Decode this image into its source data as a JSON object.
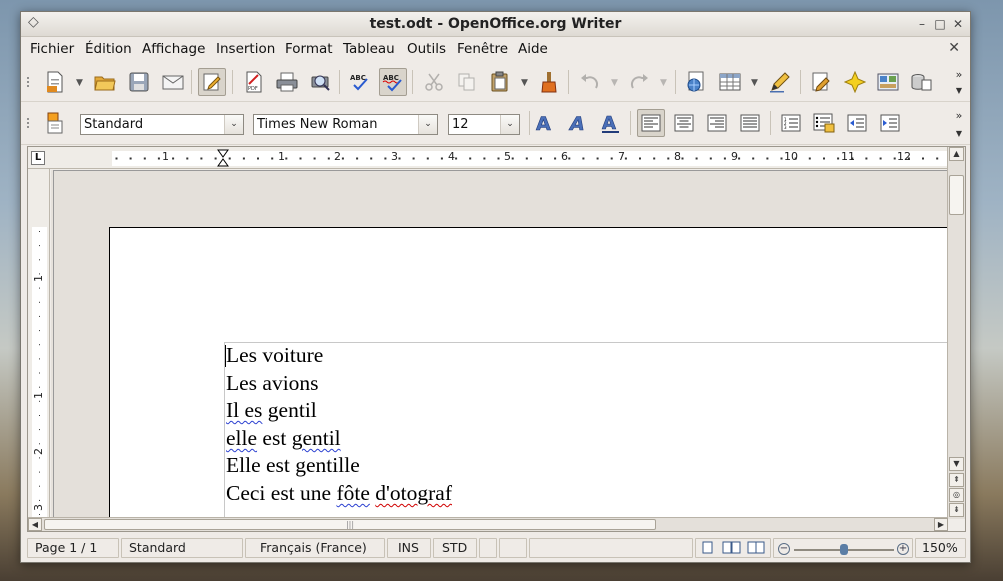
{
  "window": {
    "title": "test.odt - OpenOffice.org Writer",
    "menu_glyph": "◇",
    "minimize_glyph": "–",
    "maximize_glyph": "□",
    "close_glyph": "✕"
  },
  "menu": {
    "items": [
      "Fichier",
      "Édition",
      "Affichage",
      "Insertion",
      "Format",
      "Tableau",
      "Outils",
      "Fenêtre",
      "Aide"
    ],
    "close_doc_glyph": "✕"
  },
  "toolbar_standard": {
    "buttons": [
      {
        "icon": "new-document-icon"
      },
      {
        "icon": "open-folder-icon"
      },
      {
        "icon": "save-icon"
      },
      {
        "icon": "email-icon"
      },
      {
        "icon": "edit-file-icon",
        "pressed": true
      },
      {
        "icon": "export-pdf-icon"
      },
      {
        "icon": "print-icon"
      },
      {
        "icon": "print-preview-icon"
      },
      {
        "icon": "spellcheck-icon"
      },
      {
        "icon": "autospellcheck-icon",
        "pressed": true
      },
      {
        "icon": "cut-icon",
        "disabled": true
      },
      {
        "icon": "copy-icon",
        "disabled": true
      },
      {
        "icon": "paste-icon"
      },
      {
        "icon": "clone-formatting-icon"
      },
      {
        "icon": "undo-icon",
        "disabled": true
      },
      {
        "icon": "redo-icon",
        "disabled": true
      },
      {
        "icon": "hyperlink-icon"
      },
      {
        "icon": "table-icon"
      },
      {
        "icon": "show-draw-functions-icon"
      },
      {
        "icon": "find-replace-icon"
      },
      {
        "icon": "navigator-icon"
      },
      {
        "icon": "gallery-icon"
      },
      {
        "icon": "data-sources-icon"
      }
    ],
    "overflow": "»"
  },
  "toolbar_formatting": {
    "style_value": "Standard",
    "font_value": "Times New Roman",
    "size_value": "12",
    "dropdown_glyph": "⌄",
    "overflow": "»"
  },
  "rulers": {
    "corner_label": "L",
    "h_numbers": [
      "1",
      "1",
      "2",
      "3",
      "4",
      "5",
      "6",
      "7",
      "8",
      "9",
      "10",
      "11",
      "12"
    ],
    "v_numbers": [
      "1",
      "1",
      "2",
      "3"
    ]
  },
  "document": {
    "lines": [
      [
        {
          "t": "Les voiture",
          "s": "none"
        }
      ],
      [
        {
          "t": "Les avions",
          "s": "none"
        }
      ],
      [
        {
          "t": "Il es",
          "s": "blue"
        },
        {
          "t": " gentil",
          "s": "none"
        }
      ],
      [
        {
          "t": "elle",
          "s": "blue"
        },
        {
          "t": " est ",
          "s": "none"
        },
        {
          "t": "gentil",
          "s": "blue"
        }
      ],
      [
        {
          "t": "Elle est gentille",
          "s": "none"
        }
      ],
      [
        {
          "t": "Ceci est une ",
          "s": "none"
        },
        {
          "t": "fôte",
          "s": "blue"
        },
        {
          "t": " ",
          "s": "none"
        },
        {
          "t": "d'otograf",
          "s": "red"
        }
      ]
    ]
  },
  "statusbar": {
    "page": "Page 1 / 1",
    "style": "Standard",
    "language": "Français (France)",
    "insert_mode": "INS",
    "selection_mode": "STD",
    "zoom": "150%",
    "zoom_fraction": 0.5
  },
  "colors": {
    "spell_red": "#d00000",
    "grammar_blue": "#2a3fd0",
    "accent": "#5b7ea6"
  }
}
